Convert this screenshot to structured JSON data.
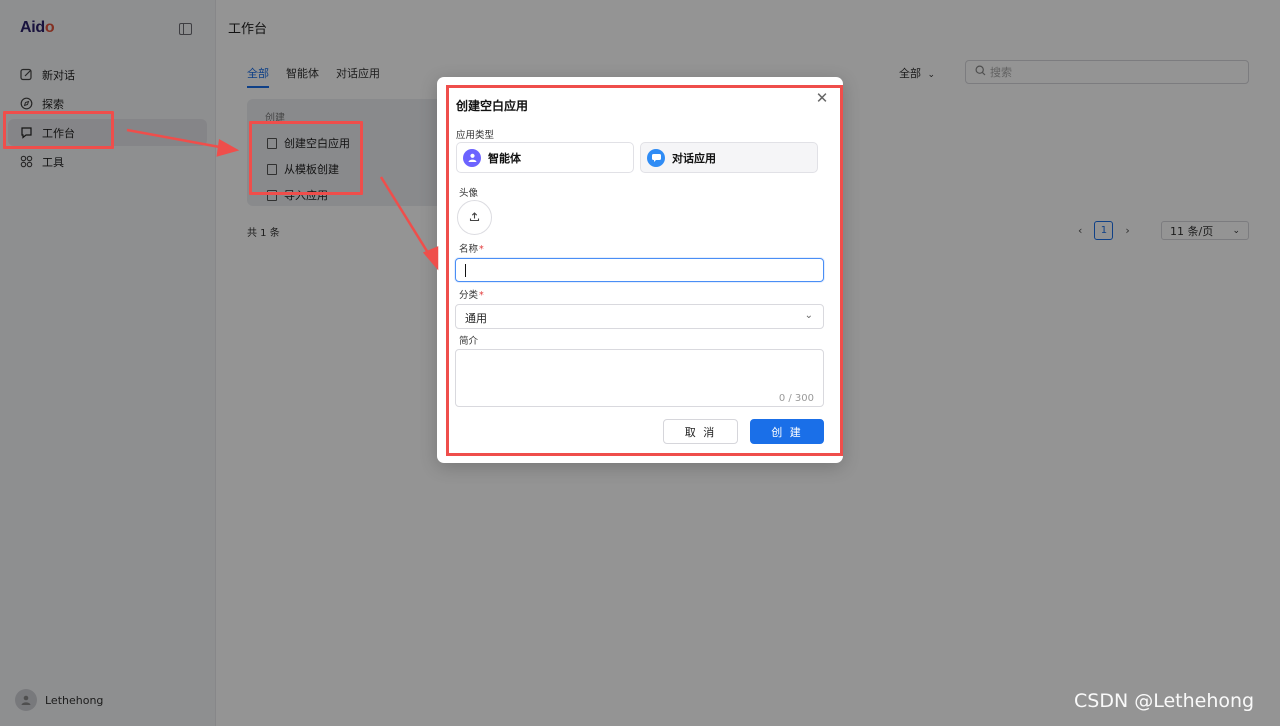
{
  "app": {
    "logo_main": "Aid",
    "logo_accent": "o"
  },
  "sidebar": {
    "items": [
      {
        "label": "新对话",
        "icon": "edit-icon"
      },
      {
        "label": "探索",
        "icon": "compass-icon"
      },
      {
        "label": "工作台",
        "icon": "workbench-icon"
      },
      {
        "label": "工具",
        "icon": "grid-icon"
      }
    ],
    "user": "Lethehong"
  },
  "main": {
    "title": "工作台",
    "tabs": [
      "全部",
      "智能体",
      "对话应用"
    ],
    "filter": "全部",
    "search_placeholder": "搜索",
    "create_card": {
      "header": "创建",
      "items": [
        "创建空白应用",
        "从模板创建",
        "导入应用"
      ]
    },
    "total": "共 1 条",
    "pagination": {
      "current": "1",
      "page_size": "11 条/页"
    }
  },
  "modal": {
    "title": "创建空白应用",
    "type_label": "应用类型",
    "types": [
      {
        "label": "智能体",
        "icon": "agent-icon",
        "color": "#6c63ff"
      },
      {
        "label": "对话应用",
        "icon": "chat-icon",
        "color": "#2f8cf5"
      }
    ],
    "avatar_label": "头像",
    "name_label": "名称",
    "name_value": "",
    "category_label": "分类",
    "category_value": "通用",
    "intro_label": "简介",
    "intro_counter": "0 / 300",
    "cancel": "取 消",
    "create": "创 建"
  },
  "watermark": "CSDN @Lethehong",
  "colors": {
    "primary": "#1a6fe8",
    "highlight": "#ef4e4b"
  }
}
